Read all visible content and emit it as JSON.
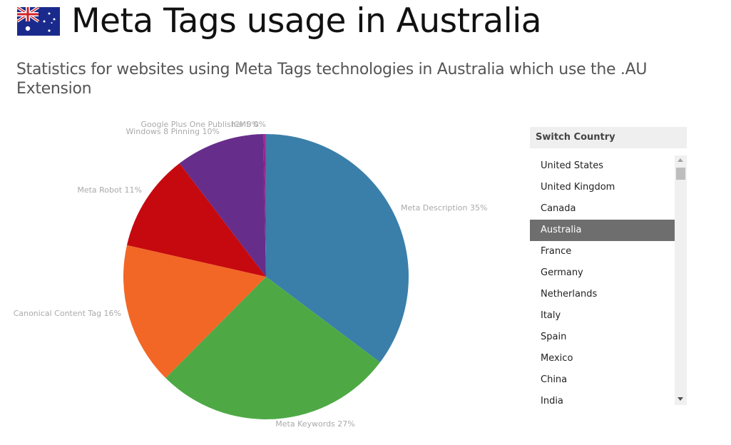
{
  "header": {
    "title": "Meta Tags usage in Australia",
    "subtitle": "Statistics for websites using Meta Tags technologies in Australia which use the .AU Extension",
    "flag_icon": "australia-flag-icon"
  },
  "switcher": {
    "heading": "Switch Country",
    "selected": "Australia",
    "countries": [
      {
        "label": "United States"
      },
      {
        "label": "United Kingdom"
      },
      {
        "label": "Canada"
      },
      {
        "label": "Australia",
        "active": true
      },
      {
        "label": "France"
      },
      {
        "label": "Germany"
      },
      {
        "label": "Netherlands"
      },
      {
        "label": "Italy"
      },
      {
        "label": "Spain"
      },
      {
        "label": "Mexico"
      },
      {
        "label": "China"
      },
      {
        "label": "India"
      }
    ]
  },
  "chart_data": {
    "type": "pie",
    "title": "",
    "slices": [
      {
        "label": "Meta Description",
        "value": 35,
        "display": "Meta Description 35%",
        "color": "#3a7fa9"
      },
      {
        "label": "Meta Keywords",
        "value": 27,
        "display": "Meta Keywords 27%",
        "color": "#4ea945"
      },
      {
        "label": "Canonical Content Tag",
        "value": 16,
        "display": "Canonical Content Tag 16%",
        "color": "#f26725"
      },
      {
        "label": "Meta Robot",
        "value": 11,
        "display": "Meta Robot 11%",
        "color": "#c6090f"
      },
      {
        "label": "Windows 8 Pinning",
        "value": 10,
        "display": "Windows 8 Pinning 10%",
        "color": "#662e8a"
      },
      {
        "label": "Google Plus One Publisher",
        "value": 0.2,
        "display": "Google Plus One Publisher 0%",
        "color": "#9b1b8a"
      },
      {
        "label": "ICMS",
        "value": 0.1,
        "display": "ICMS 0%",
        "color": "#d81b8c"
      }
    ]
  }
}
